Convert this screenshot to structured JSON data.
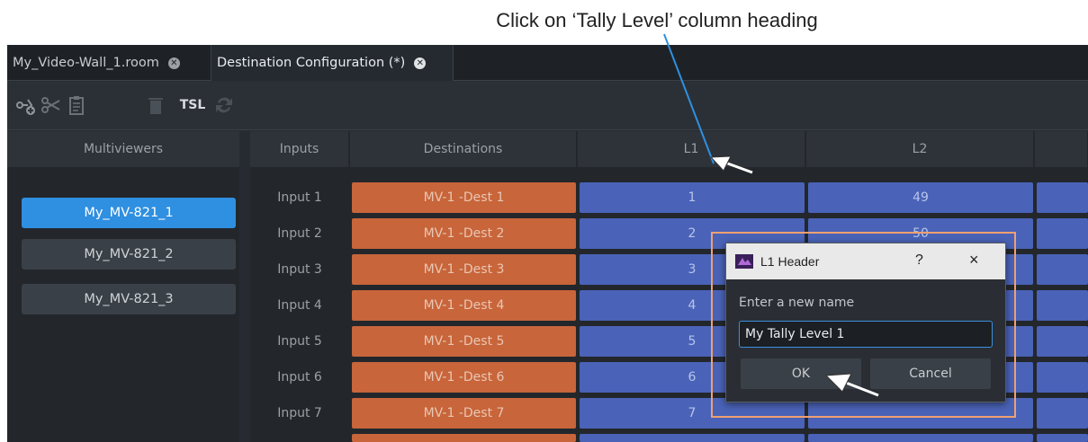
{
  "annotation": {
    "text": "Click on ‘Tally Level’ column heading"
  },
  "tabs": [
    {
      "label": "My_Video-Wall_1.room",
      "active": false
    },
    {
      "label": "Destination Configuration (*)",
      "active": true
    }
  ],
  "toolbar": {
    "tsl_label": "TSL",
    "icons": [
      "add-destination-icon",
      "scissors-icon",
      "clipboard-icon",
      "trash-icon",
      "tsl-icon",
      "refresh-icon"
    ]
  },
  "left_panel": {
    "header": "Multiviewers",
    "items": [
      {
        "label": "My_MV-821_1",
        "selected": true
      },
      {
        "label": "My_MV-821_2",
        "selected": false
      },
      {
        "label": "My_MV-821_3",
        "selected": false
      }
    ]
  },
  "grid": {
    "headers": {
      "inputs": "Inputs",
      "destinations": "Destinations",
      "l1": "L1",
      "l2": "L2"
    },
    "rows": [
      {
        "input": "Input 1",
        "destination": "MV-1 -Dest 1",
        "l1": "1",
        "l2": "49"
      },
      {
        "input": "Input 2",
        "destination": "MV-1 -Dest 2",
        "l1": "2",
        "l2": "50"
      },
      {
        "input": "Input 3",
        "destination": "MV-1 -Dest 3",
        "l1": "3",
        "l2": ""
      },
      {
        "input": "Input 4",
        "destination": "MV-1 -Dest 4",
        "l1": "4",
        "l2": ""
      },
      {
        "input": "Input 5",
        "destination": "MV-1 -Dest 5",
        "l1": "5",
        "l2": ""
      },
      {
        "input": "Input 6",
        "destination": "MV-1 -Dest 6",
        "l1": "6",
        "l2": ""
      },
      {
        "input": "Input 7",
        "destination": "MV-1 -Dest 7",
        "l1": "7",
        "l2": ""
      }
    ]
  },
  "dialog": {
    "title": "L1 Header",
    "help": "?",
    "close": "×",
    "label": "Enter a new name",
    "input_value": "My Tally Level 1",
    "ok": "OK",
    "cancel": "Cancel"
  },
  "colors": {
    "accent": "#2f8fe0",
    "destination": "#c8653a",
    "level": "#4a63b8",
    "highlight_frame": "#f0a070",
    "annotation_line": "#2f8fe0"
  }
}
